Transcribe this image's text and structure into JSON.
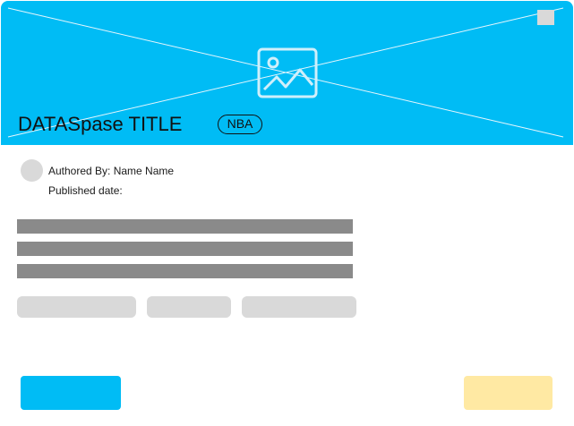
{
  "card": {
    "title": "DATASpase TITLE",
    "tag": "NBA",
    "author_line": "Authored By: Name Name",
    "published_line": "Published date:"
  },
  "colors": {
    "hero_background": "#00bcf5",
    "placeholder_gray": "#d9d9d9",
    "text_bar_gray": "#8a8a8a",
    "primary_button": "#00bcf5",
    "secondary_button": "#ffe9a3"
  },
  "icons": {
    "hero_image": "image-placeholder-icon"
  }
}
